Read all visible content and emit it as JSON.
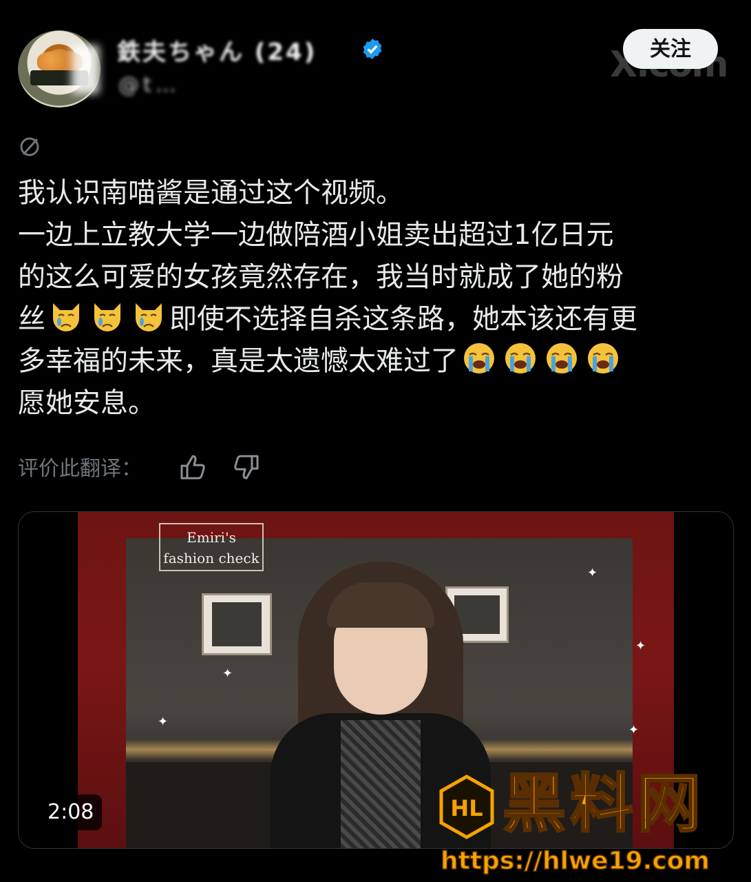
{
  "header": {
    "display_name": "鉄夫ちゃん (24)",
    "handle": "@t…",
    "follow_label": "关注",
    "watermark": "X.com"
  },
  "post": {
    "lines": [
      "我认识南喵酱是通过这个视频。",
      "一边上立教大学一边做陪酒小姐卖出超过1亿日元",
      "的这么可爱的女孩竟然存在，我当时就成了她的粉"
    ],
    "line4_prefix": "丝",
    "line4_suffix": "即使不选择自杀这条路，她本该还有更",
    "line5_prefix": "多幸福的未来，真是太遗憾太难过了",
    "line6": "愿她安息。",
    "rate_label": "评价此翻译："
  },
  "media": {
    "overlay_label_line1": "Emiri's",
    "overlay_label_line2": "fashion check",
    "duration": "2:08"
  },
  "watermark": {
    "brand": "黑料网",
    "url": "https://hlwe19.com",
    "logo_text": "HL"
  },
  "colors": {
    "background": "#000000",
    "text": "#e7e9ea",
    "muted": "#6e767d",
    "verified": "#1d9bf0",
    "watermark": "#f6a300"
  },
  "icons": [
    "verified-badge-icon",
    "translate-globe-icon",
    "crying-cat-emoji",
    "loudly-crying-emoji",
    "thumbs-up-icon",
    "thumbs-down-icon"
  ]
}
